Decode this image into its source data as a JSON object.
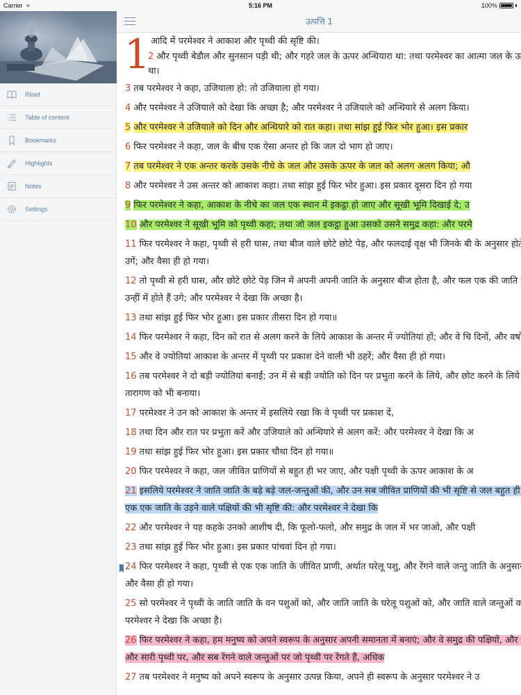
{
  "status_bar": {
    "carrier": "Carrier",
    "time": "5:16 PM",
    "battery": "100%"
  },
  "sidebar": {
    "items": [
      {
        "label": "Read",
        "icon": "read-icon"
      },
      {
        "label": "Table of content",
        "icon": "list-icon"
      },
      {
        "label": "Bookmarks",
        "icon": "bookmark-icon"
      },
      {
        "label": "Highlights",
        "icon": "highlighter-icon"
      },
      {
        "label": "Notes",
        "icon": "notes-icon"
      },
      {
        "label": "Settings",
        "icon": "gear-icon"
      }
    ]
  },
  "header": {
    "title": "उत्पत्ति 1"
  },
  "chapter": {
    "number": "1",
    "verse1": "आदि में परमेश्वर ने आकाश और पृथ्वी की सृष्टि की।",
    "verse2_num": "2",
    "verse2": "और पृथ्वी बेडौल और सुनसान पड़ी थी; और गहरे जल के ऊपर अन्धियारा था: तथा परमेश्वर का आत्मा जल के ऊपर मण्डलाता था।",
    "verses": [
      {
        "num": "3",
        "text": "तब परमेश्वर ने कहा, उजियाला हो: तो उजियाला हो गया।",
        "highlight": "none"
      },
      {
        "num": "4",
        "text": "और परमेश्वर ने उजियाले को देखा कि अच्छा है; और परमेश्वर ने उजियाले को अन्धियारे से अलग किया।",
        "highlight": "none"
      },
      {
        "num": "5",
        "text": "और परमेश्वर ने उजियाले को दिन और अन्धियारे को रात कहा। तथा सांझ हुई फिर भोर हुआ। इस प्रकार",
        "highlight": "yellow"
      },
      {
        "num": "6",
        "text": "फिर परमेश्वर ने कहा, जल के बीच एक ऐसा अन्तर हो कि जल दो भाग हो जाए।",
        "highlight": "none"
      },
      {
        "num": "7",
        "text": "तब परमेश्वर ने एक अन्तर करके उसके नीचे के जल और उसके ऊपर के जल को अलग अलग किया; औ",
        "highlight": "yellow"
      },
      {
        "num": "8",
        "text": "और परमेश्वर ने उस अन्तर को आकाश कहा। तथा सांझ हुई फिर भोर हुआ। इस प्रकार दूसरा दिन हो गया",
        "highlight": "none"
      },
      {
        "num": "9",
        "text": "फिर परमेश्वर ने कहा, आकाश के नीचे का जल एक स्थान में इकट्ठा हो जाए और सूखी भूमि दिखाई दे; उ",
        "highlight": "green"
      },
      {
        "num": "10",
        "text": "और परमेश्वर ने सूखी भूमि को पृथ्वी कहा; तथा जो जल इकट्ठा हुआ उसको उसने समुद्र कहा: और परमे",
        "highlight": "green"
      },
      {
        "num": "11",
        "text": "फिर परमेश्वर ने कहा, पृथ्वी से हरी घास, तथा बीज वाले छोटे छोटे पेड़, और फलदाई वृक्ष भी जिनके बी के अनुसार होते हैं पृथ्वी पर उगें; और वैसा ही हो गया।",
        "highlight": "none"
      },
      {
        "num": "12",
        "text": "तो पृथ्वी से हरी घास, और छोटे छोटे पेड़ जिन में अपनी अपनी जाति के अनुसार बीज होता है, और फल एक की जाति के अनुसार उन्हीं में होते हैं उगे; और परमेश्वर ने देखा कि अच्छा है।",
        "highlight": "none"
      },
      {
        "num": "13",
        "text": "तथा सांझ हुई फिर भोर हुआ। इस प्रकार तीसरा दिन हो गया॥",
        "highlight": "none"
      },
      {
        "num": "14",
        "text": "फिर परमेश्वर ने कहा, दिन को रात से अलग करने के लिये आकाश के अन्तर में ज्योतियां हों; और वे चि दिनों, और वर्षों के कारण हों।",
        "highlight": "none"
      },
      {
        "num": "15",
        "text": "और वे ज्योतियां आकाश के अन्तर में पृथ्वी पर प्रकाश देने वाली भी ठहरें; और वैसा ही हो गया।",
        "highlight": "none"
      },
      {
        "num": "16",
        "text": "तब परमेश्वर ने दो बड़ी ज्योतियां बनाईं; उन में से बड़ी ज्योति को दिन पर प्रभुता करने के लिये, और छोट करने के लिये बनाया: और तारागण को भी बनाया।",
        "highlight": "none"
      },
      {
        "num": "17",
        "text": "परमेश्वर ने उन को आकाश के अन्तर में इसलिये रखा कि वे पृथ्वी पर प्रकाश दें,",
        "highlight": "none"
      },
      {
        "num": "18",
        "text": "तथा दिन और रात पर प्रभुता करें और उजियाले को अन्धियारे से अलग करें: और परमेश्वर ने देखा कि अ",
        "highlight": "none"
      },
      {
        "num": "19",
        "text": "तथा सांझ हुई फिर भोर हुआ। इस प्रकार चौथा दिन हो गया॥",
        "highlight": "none"
      },
      {
        "num": "20",
        "text": "फिर परमेश्वर ने कहा, जल जीवित प्राणियों से बहुत ही भर जाए, और पक्षी पृथ्वी के ऊपर आकाश के अ",
        "highlight": "none"
      },
      {
        "num": "21",
        "text": "इसलिये परमेश्वर ने जाति जाति के बड़े बड़े जल-जन्तुओं की, और उन सब जीवित प्राणियों की भी सृष्टि से जल बहुत ही भर गया और एक एक जाति के उड़ने वाले पक्षियों की भी सृष्टि की: और परमेश्वर ने देखा कि",
        "highlight": "blue"
      },
      {
        "num": "22",
        "text": "और परमेश्वर ने यह कहके उनको आशीष दी, कि फूलो-फलो, और समुद्र के जल में भर जाओ, और पक्षी",
        "highlight": "none"
      },
      {
        "num": "23",
        "text": "तथा सांझ हुई फिर भोर हुआ। इस प्रकार पांचवां दिन हो गया।",
        "highlight": "none"
      },
      {
        "num": "24",
        "text": "फिर परमेश्वर ने कहा, पृथ्वी से एक एक जाति के जीवित प्राणी, अर्थात घरेलू पशु, और रेंगने वाले जन्तु जाति के अनुसार उत्पन्न हों; और वैसा ही हो गया।",
        "highlight": "none",
        "bookmarked": true
      },
      {
        "num": "25",
        "text": "सो परमेश्वर ने पृथ्वी के जाति जाति के वन पशुओं को, और जाति जाति के घरेलू पशुओं को, और जाति वाले जन्तुओं को बनाया: और परमेश्वर ने देखा कि अच्छा है।",
        "highlight": "none"
      },
      {
        "num": "26",
        "text": "फिर परमेश्वर ने कहा, हम मनुष्य को अपने स्वरूप के अनुसार अपनी समानता में बनाएं; और वे समुद्र की पक्षियों, और घरेलू पशुओं, और सारी पृथ्वी पर, और सब रेंगने वाले जन्तुओं पर जो पृथ्वी पर रेंगते हैं, अधिक",
        "highlight": "pink"
      },
      {
        "num": "27",
        "text": "तब परमेश्वर ने मनुष्य को अपने स्वरूप के अनुसार उत्पन्न किया, अपने ही स्वरूप के अनुसार परमेश्वर ने उ",
        "highlight": "none"
      }
    ]
  }
}
